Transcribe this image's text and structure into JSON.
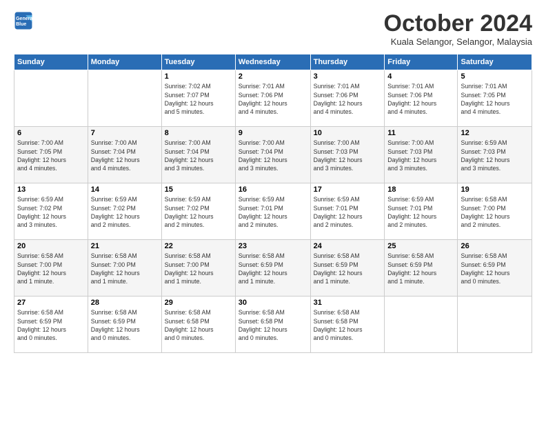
{
  "logo": {
    "line1": "General",
    "line2": "Blue"
  },
  "title": "October 2024",
  "location": "Kuala Selangor, Selangor, Malaysia",
  "days_of_week": [
    "Sunday",
    "Monday",
    "Tuesday",
    "Wednesday",
    "Thursday",
    "Friday",
    "Saturday"
  ],
  "weeks": [
    [
      {
        "day": "",
        "info": ""
      },
      {
        "day": "",
        "info": ""
      },
      {
        "day": "1",
        "info": "Sunrise: 7:02 AM\nSunset: 7:07 PM\nDaylight: 12 hours\nand 5 minutes."
      },
      {
        "day": "2",
        "info": "Sunrise: 7:01 AM\nSunset: 7:06 PM\nDaylight: 12 hours\nand 4 minutes."
      },
      {
        "day": "3",
        "info": "Sunrise: 7:01 AM\nSunset: 7:06 PM\nDaylight: 12 hours\nand 4 minutes."
      },
      {
        "day": "4",
        "info": "Sunrise: 7:01 AM\nSunset: 7:06 PM\nDaylight: 12 hours\nand 4 minutes."
      },
      {
        "day": "5",
        "info": "Sunrise: 7:01 AM\nSunset: 7:05 PM\nDaylight: 12 hours\nand 4 minutes."
      }
    ],
    [
      {
        "day": "6",
        "info": "Sunrise: 7:00 AM\nSunset: 7:05 PM\nDaylight: 12 hours\nand 4 minutes."
      },
      {
        "day": "7",
        "info": "Sunrise: 7:00 AM\nSunset: 7:04 PM\nDaylight: 12 hours\nand 4 minutes."
      },
      {
        "day": "8",
        "info": "Sunrise: 7:00 AM\nSunset: 7:04 PM\nDaylight: 12 hours\nand 3 minutes."
      },
      {
        "day": "9",
        "info": "Sunrise: 7:00 AM\nSunset: 7:04 PM\nDaylight: 12 hours\nand 3 minutes."
      },
      {
        "day": "10",
        "info": "Sunrise: 7:00 AM\nSunset: 7:03 PM\nDaylight: 12 hours\nand 3 minutes."
      },
      {
        "day": "11",
        "info": "Sunrise: 7:00 AM\nSunset: 7:03 PM\nDaylight: 12 hours\nand 3 minutes."
      },
      {
        "day": "12",
        "info": "Sunrise: 6:59 AM\nSunset: 7:03 PM\nDaylight: 12 hours\nand 3 minutes."
      }
    ],
    [
      {
        "day": "13",
        "info": "Sunrise: 6:59 AM\nSunset: 7:02 PM\nDaylight: 12 hours\nand 3 minutes."
      },
      {
        "day": "14",
        "info": "Sunrise: 6:59 AM\nSunset: 7:02 PM\nDaylight: 12 hours\nand 2 minutes."
      },
      {
        "day": "15",
        "info": "Sunrise: 6:59 AM\nSunset: 7:02 PM\nDaylight: 12 hours\nand 2 minutes."
      },
      {
        "day": "16",
        "info": "Sunrise: 6:59 AM\nSunset: 7:01 PM\nDaylight: 12 hours\nand 2 minutes."
      },
      {
        "day": "17",
        "info": "Sunrise: 6:59 AM\nSunset: 7:01 PM\nDaylight: 12 hours\nand 2 minutes."
      },
      {
        "day": "18",
        "info": "Sunrise: 6:59 AM\nSunset: 7:01 PM\nDaylight: 12 hours\nand 2 minutes."
      },
      {
        "day": "19",
        "info": "Sunrise: 6:58 AM\nSunset: 7:00 PM\nDaylight: 12 hours\nand 2 minutes."
      }
    ],
    [
      {
        "day": "20",
        "info": "Sunrise: 6:58 AM\nSunset: 7:00 PM\nDaylight: 12 hours\nand 1 minute."
      },
      {
        "day": "21",
        "info": "Sunrise: 6:58 AM\nSunset: 7:00 PM\nDaylight: 12 hours\nand 1 minute."
      },
      {
        "day": "22",
        "info": "Sunrise: 6:58 AM\nSunset: 7:00 PM\nDaylight: 12 hours\nand 1 minute."
      },
      {
        "day": "23",
        "info": "Sunrise: 6:58 AM\nSunset: 6:59 PM\nDaylight: 12 hours\nand 1 minute."
      },
      {
        "day": "24",
        "info": "Sunrise: 6:58 AM\nSunset: 6:59 PM\nDaylight: 12 hours\nand 1 minute."
      },
      {
        "day": "25",
        "info": "Sunrise: 6:58 AM\nSunset: 6:59 PM\nDaylight: 12 hours\nand 1 minute."
      },
      {
        "day": "26",
        "info": "Sunrise: 6:58 AM\nSunset: 6:59 PM\nDaylight: 12 hours\nand 0 minutes."
      }
    ],
    [
      {
        "day": "27",
        "info": "Sunrise: 6:58 AM\nSunset: 6:59 PM\nDaylight: 12 hours\nand 0 minutes."
      },
      {
        "day": "28",
        "info": "Sunrise: 6:58 AM\nSunset: 6:59 PM\nDaylight: 12 hours\nand 0 minutes."
      },
      {
        "day": "29",
        "info": "Sunrise: 6:58 AM\nSunset: 6:58 PM\nDaylight: 12 hours\nand 0 minutes."
      },
      {
        "day": "30",
        "info": "Sunrise: 6:58 AM\nSunset: 6:58 PM\nDaylight: 12 hours\nand 0 minutes."
      },
      {
        "day": "31",
        "info": "Sunrise: 6:58 AM\nSunset: 6:58 PM\nDaylight: 12 hours\nand 0 minutes."
      },
      {
        "day": "",
        "info": ""
      },
      {
        "day": "",
        "info": ""
      }
    ]
  ]
}
